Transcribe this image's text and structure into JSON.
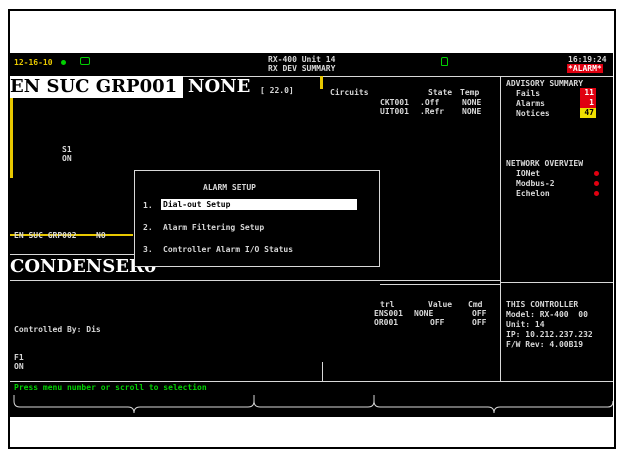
{
  "header": {
    "date": "12-16-10",
    "unit_title": "RX-400 Unit 14",
    "screen_name": "RX DEV SUMMARY",
    "time": "16:19:24",
    "alarm_label": "*ALARM*"
  },
  "group": {
    "name": "EN SUC GRP001",
    "status": "NONE",
    "value": "[ 22.0]"
  },
  "circuits": {
    "title": "Circuits",
    "headers": [
      "State",
      "Temp"
    ],
    "rows": [
      {
        "name": "CKT001",
        "state": ".Off",
        "temp": "NONE"
      },
      {
        "name": "UIT001",
        "state": ".Refr",
        "temp": "NONE"
      }
    ]
  },
  "s1": {
    "label": "S1",
    "state": "ON"
  },
  "group2": {
    "name": "EN SUC GRP002",
    "suffix": "NO"
  },
  "condenser": {
    "name": "CONDENSER0",
    "controlled_by": "Controlled By: Dis"
  },
  "f1": {
    "label": "F1",
    "state": "ON"
  },
  "condenser_table": {
    "headers": [
      "trl",
      "Value",
      "Cmd"
    ],
    "rows": [
      {
        "name": "ENS001",
        "value": "NONE",
        "cmd": "OFF"
      },
      {
        "name": "OR001",
        "value": "OFF",
        "cmd": "OFF"
      }
    ]
  },
  "advisory": {
    "title": "ADVISORY SUMMARY",
    "rows": [
      {
        "label": "Fails",
        "count": "11",
        "color": "#e00010",
        "text_color": "#ffffff"
      },
      {
        "label": "Alarms",
        "count": "1",
        "color": "#e00010",
        "text_color": "#ffffff"
      },
      {
        "label": "Notices",
        "count": "47",
        "color": "#f0e000",
        "text_color": "#000000"
      }
    ]
  },
  "network": {
    "title": "NETWORK OVERVIEW",
    "items": [
      "IONet",
      "Modbus-2",
      "Echelon"
    ],
    "status_color": "#e00010"
  },
  "controller": {
    "title": "THIS CONTROLLER",
    "model": "Model: RX-400  00",
    "unit": "Unit: 14",
    "ip": "IP: 10.212.237.232",
    "fw": "F/W Rev: 4.00B19"
  },
  "dialog": {
    "title": "ALARM SETUP",
    "options": [
      {
        "num": "1.",
        "label": "Dial-out Setup"
      },
      {
        "num": "2.",
        "label": "Alarm Filtering Setup"
      },
      {
        "num": "3.",
        "label": "Controller Alarm I/O Status"
      }
    ]
  },
  "status_bar": {
    "text": "Press menu number or scroll to selection",
    "color": "#00d000"
  },
  "colors": {
    "accent_yellow": "#e8c800",
    "alarm_red": "#e00010",
    "green": "#00d000"
  },
  "icons": [
    "status-dot-icon",
    "monitor-icon",
    "lock-icon"
  ]
}
